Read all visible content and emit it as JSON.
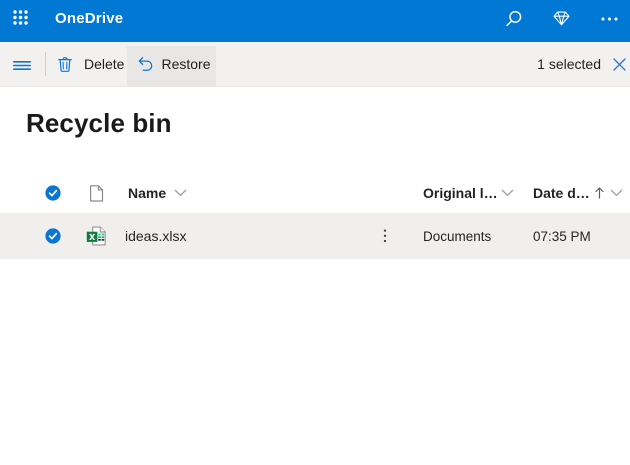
{
  "colors": {
    "brand": "#0078d4",
    "toolbar_bg": "#f2f1f0",
    "restore_hover_bg": "#e9e7e5",
    "selected_row_bg": "#f0efee",
    "text": "#252423",
    "icon_blue": "#0b76d1",
    "close_blue": "#3270d3",
    "muted_gray": "#8a8886"
  },
  "suite_bar": {
    "app_title": "OneDrive",
    "icons": [
      "app-launcher",
      "search",
      "premium-diamond",
      "more-options"
    ]
  },
  "command_bar": {
    "buttons": [
      {
        "label": "Delete",
        "icon": "trash"
      },
      {
        "label": "Restore",
        "icon": "restore-arrow",
        "hovered": true
      }
    ],
    "selection_status": "1 selected",
    "close_icon": "close"
  },
  "page": {
    "title": "Recycle bin"
  },
  "table": {
    "headers": [
      {
        "label": "Name",
        "chevron": true
      },
      {
        "label": "Original l…",
        "chevron": true
      },
      {
        "label": "Date d…",
        "sort": "ascending",
        "chevron": true
      }
    ],
    "rows": [
      {
        "selected": true,
        "file_type": "excel-workbook",
        "name": "ideas.xlsx",
        "original_location": "Documents",
        "date_deleted": "07:35 PM"
      }
    ]
  }
}
